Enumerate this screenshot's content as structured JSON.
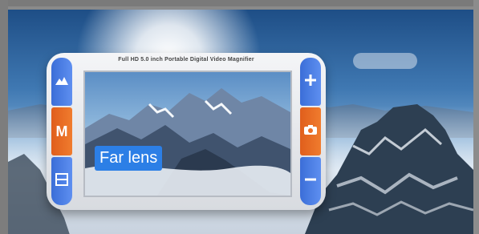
{
  "device": {
    "caption": "Full HD 5.0 inch Portable Digital Video Magnifier",
    "screen_label": "Far lens",
    "left_buttons": [
      {
        "icon": "mountain-icon"
      },
      {
        "label": "M"
      },
      {
        "icon": "split-view-icon"
      }
    ],
    "right_buttons": [
      {
        "icon": "plus-icon"
      },
      {
        "icon": "camera-icon"
      },
      {
        "icon": "minus-icon"
      }
    ]
  },
  "colors": {
    "button_blue": "#4a7fe4",
    "button_orange": "#ea6d26",
    "label_blue": "#2c7fe6"
  }
}
